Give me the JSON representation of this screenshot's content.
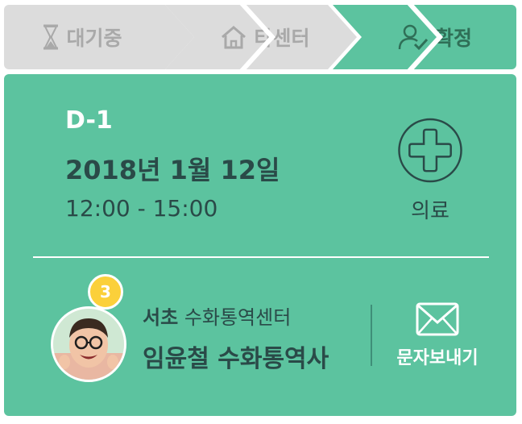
{
  "steps": [
    {
      "label": "대기중",
      "icon": "hourglass-icon",
      "state": "inactive"
    },
    {
      "label": "타센터",
      "icon": "home-icon",
      "state": "inactive"
    },
    {
      "label": "확정",
      "icon": "user-check-icon",
      "state": "active"
    }
  ],
  "colors": {
    "accent": "#5cc39f",
    "inactive_step": "#dcdcdc",
    "inactive_text": "#a9a9a9",
    "dark_text": "#2a4a48",
    "badge": "#fbd03a"
  },
  "schedule": {
    "dday": "D-1",
    "date": "2018년 1월 12일",
    "time": "12:00 - 15:00",
    "category_icon": "medical-cross-icon",
    "category_label": "의료"
  },
  "interpreter": {
    "avatar": "avatar-photo",
    "badge_count": "3",
    "center_bold": "서초",
    "center_rest": "수화통역센터",
    "name": "임윤철 수화통역사"
  },
  "actions": {
    "sms_icon": "envelope-icon",
    "sms_label": "문자보내기"
  }
}
